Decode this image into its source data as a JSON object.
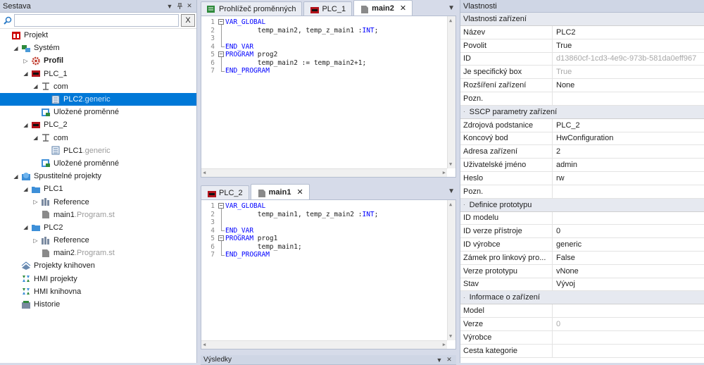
{
  "left_panel": {
    "title": "Sestava",
    "pin_icon": "pin-icon",
    "search_value": "",
    "clear_label": "X",
    "tree": [
      {
        "id": "projekt",
        "level": 0,
        "expander": "",
        "icon": "project-icon",
        "label": "Projekt",
        "suffix": "",
        "bold": false,
        "selected": false
      },
      {
        "id": "system",
        "level": 1,
        "expander": "◢",
        "icon": "system-icon",
        "label": "Systém",
        "suffix": "",
        "bold": false,
        "selected": false
      },
      {
        "id": "profil",
        "level": 2,
        "expander": "▷",
        "icon": "gear-icon",
        "label": "Profil",
        "suffix": "",
        "bold": true,
        "selected": false
      },
      {
        "id": "plc1",
        "level": 2,
        "expander": "◢",
        "icon": "plc-icon",
        "label": "PLC_1",
        "suffix": "",
        "bold": false,
        "selected": false
      },
      {
        "id": "plc1-com",
        "level": 3,
        "expander": "◢",
        "icon": "network-icon",
        "label": "com",
        "suffix": "",
        "bold": false,
        "selected": false
      },
      {
        "id": "plc2-generic",
        "level": 4,
        "expander": "",
        "icon": "device-icon",
        "label": "PLC2",
        "suffix": ".generic",
        "bold": false,
        "selected": true
      },
      {
        "id": "plc1-vars",
        "level": 3,
        "expander": "",
        "icon": "variables-icon",
        "label": "Uložené proměnné",
        "suffix": "",
        "bold": false,
        "selected": false
      },
      {
        "id": "plc2",
        "level": 2,
        "expander": "◢",
        "icon": "plc-icon",
        "label": "PLC_2",
        "suffix": "",
        "bold": false,
        "selected": false
      },
      {
        "id": "plc2-com",
        "level": 3,
        "expander": "◢",
        "icon": "network-icon",
        "label": "com",
        "suffix": "",
        "bold": false,
        "selected": false
      },
      {
        "id": "plc1-generic",
        "level": 4,
        "expander": "",
        "icon": "device-icon",
        "label": "PLC1",
        "suffix": ".generic",
        "bold": false,
        "selected": false
      },
      {
        "id": "plc2-vars",
        "level": 3,
        "expander": "",
        "icon": "variables-icon",
        "label": "Uložené proměnné",
        "suffix": "",
        "bold": false,
        "selected": false
      },
      {
        "id": "spustitelne",
        "level": 1,
        "expander": "◢",
        "icon": "runnable-icon",
        "label": "Spustitelné projekty",
        "suffix": "",
        "bold": false,
        "selected": false
      },
      {
        "id": "proj-plc1",
        "level": 2,
        "expander": "◢",
        "icon": "folder-icon",
        "label": "PLC1",
        "suffix": "",
        "bold": false,
        "selected": false
      },
      {
        "id": "ref1",
        "level": 3,
        "expander": "▷",
        "icon": "reference-icon",
        "label": "Reference",
        "suffix": "",
        "bold": false,
        "selected": false
      },
      {
        "id": "main1",
        "level": 3,
        "expander": "",
        "icon": "file-icon",
        "label": "main1",
        "suffix": ".Program.st",
        "bold": false,
        "selected": false
      },
      {
        "id": "proj-plc2",
        "level": 2,
        "expander": "◢",
        "icon": "folder-icon",
        "label": "PLC2",
        "suffix": "",
        "bold": false,
        "selected": false
      },
      {
        "id": "ref2",
        "level": 3,
        "expander": "▷",
        "icon": "reference-icon",
        "label": "Reference",
        "suffix": "",
        "bold": false,
        "selected": false
      },
      {
        "id": "main2",
        "level": 3,
        "expander": "",
        "icon": "file-icon",
        "label": "main2",
        "suffix": ".Program.st",
        "bold": false,
        "selected": false
      },
      {
        "id": "knihoven",
        "level": 1,
        "expander": "",
        "icon": "library-icon",
        "label": "Projekty knihoven",
        "suffix": "",
        "bold": false,
        "selected": false
      },
      {
        "id": "hmi-proj",
        "level": 1,
        "expander": "",
        "icon": "hmi-icon",
        "label": "HMI projekty",
        "suffix": "",
        "bold": false,
        "selected": false
      },
      {
        "id": "hmi-lib",
        "level": 1,
        "expander": "",
        "icon": "hmi-icon",
        "label": "HMI knihovna",
        "suffix": "",
        "bold": false,
        "selected": false
      },
      {
        "id": "historie",
        "level": 1,
        "expander": "",
        "icon": "history-icon",
        "label": "Historie",
        "suffix": "",
        "bold": false,
        "selected": false
      }
    ]
  },
  "editor_top": {
    "tabs": [
      {
        "label": "Prohlížeč proměnných",
        "icon": "variable-viewer-icon",
        "active": false,
        "closable": false
      },
      {
        "label": "PLC_1",
        "icon": "plc-icon",
        "active": false,
        "closable": false
      },
      {
        "label": "main2",
        "icon": "file-icon",
        "active": true,
        "closable": true
      }
    ],
    "close_label": "✕",
    "lines": [
      {
        "n": "1",
        "fold": "open",
        "segments": [
          {
            "t": "VAR_GLOBAL",
            "kw": true
          }
        ]
      },
      {
        "n": "2",
        "fold": "line",
        "segments": [
          {
            "t": "        temp_main2, temp_z_main1 :",
            "kw": false
          },
          {
            "t": "INT",
            "kw": true
          },
          {
            "t": ";",
            "kw": false
          }
        ]
      },
      {
        "n": "3",
        "fold": "line",
        "segments": []
      },
      {
        "n": "4",
        "fold": "end",
        "segments": [
          {
            "t": "END_VAR",
            "kw": true
          }
        ]
      },
      {
        "n": "5",
        "fold": "open",
        "segments": [
          {
            "t": "PROGRAM",
            "kw": true
          },
          {
            "t": " prog2",
            "kw": false
          }
        ]
      },
      {
        "n": "6",
        "fold": "line",
        "segments": [
          {
            "t": "        temp_main2 := temp_main2+1;",
            "kw": false
          }
        ]
      },
      {
        "n": "7",
        "fold": "end",
        "segments": [
          {
            "t": "END_PROGRAM",
            "kw": true
          }
        ]
      }
    ]
  },
  "editor_bottom": {
    "tabs": [
      {
        "label": "PLC_2",
        "icon": "plc-icon",
        "active": false,
        "closable": false
      },
      {
        "label": "main1",
        "icon": "file-icon",
        "active": true,
        "closable": true
      }
    ],
    "close_label": "✕",
    "lines": [
      {
        "n": "1",
        "fold": "open",
        "segments": [
          {
            "t": "VAR_GLOBAL",
            "kw": true
          }
        ]
      },
      {
        "n": "2",
        "fold": "line",
        "segments": [
          {
            "t": "        temp_main1, temp_z_main2 :",
            "kw": false
          },
          {
            "t": "INT",
            "kw": true
          },
          {
            "t": ";",
            "kw": false
          }
        ]
      },
      {
        "n": "3",
        "fold": "line",
        "segments": []
      },
      {
        "n": "4",
        "fold": "end",
        "segments": [
          {
            "t": "END_VAR",
            "kw": true
          }
        ]
      },
      {
        "n": "5",
        "fold": "open",
        "segments": [
          {
            "t": "PROGRAM",
            "kw": true
          },
          {
            "t": " prog1",
            "kw": false
          }
        ]
      },
      {
        "n": "6",
        "fold": "line",
        "segments": [
          {
            "t": "        temp_main1;",
            "kw": false
          }
        ]
      },
      {
        "n": "7",
        "fold": "end",
        "segments": [
          {
            "t": "END_PROGRAM",
            "kw": true
          }
        ]
      }
    ]
  },
  "bottom_panel": {
    "title": "Výsledky"
  },
  "properties": {
    "title": "Vlastnosti",
    "sections": [
      {
        "title": "Vlastnosti zařízení",
        "collapsible": false,
        "rows": [
          {
            "key": "Název",
            "value": "PLC2",
            "grey": false
          },
          {
            "key": "Povolit",
            "value": "True",
            "grey": false
          },
          {
            "key": "ID",
            "value": "d13860cf-1cd3-4e9c-973b-581da0eff967",
            "grey": true
          },
          {
            "key": "Je specifický box",
            "value": "True",
            "grey": true
          },
          {
            "key": "Rozšíření zařízení",
            "value": "None",
            "grey": false
          },
          {
            "key": "Pozn.",
            "value": "",
            "grey": false
          }
        ]
      },
      {
        "title": "SSCP parametry zařízení",
        "collapsible": true,
        "rows": [
          {
            "key": "Zdrojová podstanice",
            "value": "PLC_2",
            "grey": false
          },
          {
            "key": "Koncový bod",
            "value": "HwConfiguration",
            "grey": false
          },
          {
            "key": "Adresa zařízení",
            "value": "2",
            "grey": false
          },
          {
            "key": "Uživatelské jméno",
            "value": "admin",
            "grey": false
          },
          {
            "key": "Heslo",
            "value": "rw",
            "grey": false
          },
          {
            "key": "Pozn.",
            "value": "",
            "grey": false
          }
        ]
      },
      {
        "title": "Definice prototypu",
        "collapsible": true,
        "rows": [
          {
            "key": "ID modelu",
            "value": "",
            "grey": false
          },
          {
            "key": "ID verze přístroje",
            "value": "0",
            "grey": false
          },
          {
            "key": "ID výrobce",
            "value": "generic",
            "grey": false
          },
          {
            "key": "Zámek pro linkový pro...",
            "value": "False",
            "grey": false
          },
          {
            "key": "Verze prototypu",
            "value": "vNone",
            "grey": false
          },
          {
            "key": "Stav",
            "value": "Vývoj",
            "grey": false
          }
        ]
      },
      {
        "title": "Informace o zařízení",
        "collapsible": true,
        "rows": [
          {
            "key": "Model",
            "value": "",
            "grey": false
          },
          {
            "key": "Verze",
            "value": "0",
            "grey": true
          },
          {
            "key": "Výrobce",
            "value": "",
            "grey": false
          },
          {
            "key": "Cesta kategorie",
            "value": "",
            "grey": false
          }
        ]
      }
    ]
  }
}
